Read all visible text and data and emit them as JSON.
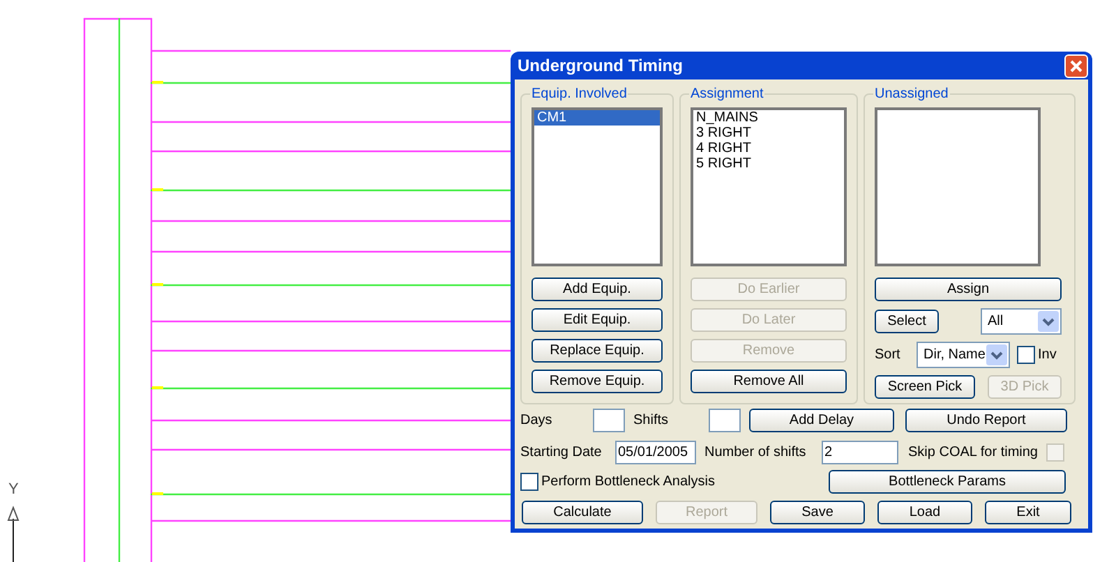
{
  "window": {
    "title": "Underground Timing"
  },
  "groups": [
    {
      "kind": "list",
      "label": "Equip. Involved",
      "items": [
        {
          "text": "CM1",
          "selected": true
        }
      ],
      "buttons": [
        {
          "label": "Add Equip.",
          "disabled": false
        },
        {
          "label": "Edit Equip.",
          "disabled": false
        },
        {
          "label": "Replace Equip.",
          "disabled": false
        },
        {
          "label": "Remove Equip.",
          "disabled": false
        }
      ]
    },
    {
      "kind": "list",
      "label": "Assignment",
      "items": [
        {
          "text": "N_MAINS",
          "selected": false
        },
        {
          "text": "3 RIGHT",
          "selected": false
        },
        {
          "text": "4 RIGHT",
          "selected": false
        },
        {
          "text": "5 RIGHT",
          "selected": false
        }
      ],
      "buttons": [
        {
          "label": "Do Earlier",
          "disabled": true
        },
        {
          "label": "Do Later",
          "disabled": true
        },
        {
          "label": "Remove",
          "disabled": true
        },
        {
          "label": "Remove All",
          "disabled": false
        }
      ]
    },
    {
      "kind": "unassigned",
      "label": "Unassigned",
      "assign_button": {
        "label": "Assign",
        "disabled": false
      },
      "select_button": {
        "label": "Select",
        "disabled": false
      },
      "filter": {
        "value": "All"
      },
      "sort": {
        "label": "Sort",
        "value": "Dir, Name"
      },
      "invert": {
        "label": "Inv",
        "checked": false
      },
      "screen_pick": {
        "label": "Screen Pick",
        "disabled": false
      },
      "pick_3d": {
        "label": "3D Pick",
        "disabled": true
      }
    }
  ],
  "delay": {
    "days_label": "Days",
    "shifts_label": "Shifts",
    "add_button": {
      "label": "Add Delay",
      "disabled": false
    },
    "undo_button": {
      "label": "Undo Report",
      "disabled": false
    }
  },
  "schedule": {
    "start_label": "Starting Date",
    "start_value": "05/01/2005",
    "shifts_label": "Number of shifts",
    "shifts_value": "2",
    "skip_coal": {
      "label": "Skip COAL for timing",
      "checked": false,
      "disabled": true
    }
  },
  "bottleneck": {
    "label": "Perform Bottleneck Analysis",
    "checked": false,
    "params_button": {
      "label": "Bottleneck Params",
      "disabled": false
    }
  },
  "actions": [
    {
      "label": "Calculate",
      "disabled": false
    },
    {
      "label": "Report",
      "disabled": true
    },
    {
      "label": "Save",
      "disabled": false
    },
    {
      "label": "Load",
      "disabled": false
    },
    {
      "label": "Exit",
      "disabled": false
    }
  ],
  "axis_label": "Y"
}
